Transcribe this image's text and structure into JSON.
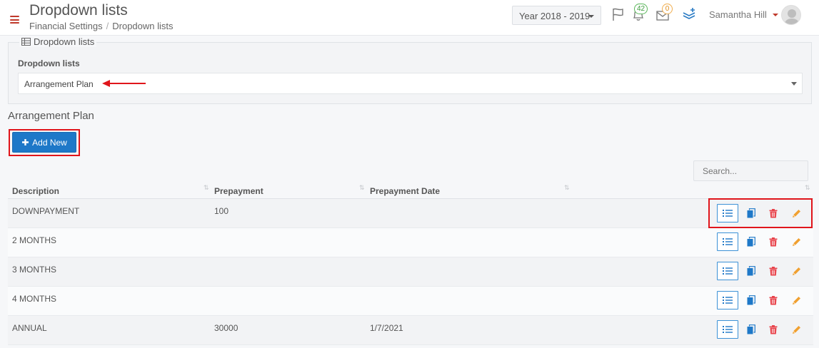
{
  "header": {
    "title": "Dropdown lists",
    "breadcrumb": [
      "Financial Settings",
      "Dropdown lists"
    ],
    "year_select": "Year 2018 - 2019",
    "notifications_count": "42",
    "messages_count": "0",
    "user_name": "Samantha Hill"
  },
  "filter": {
    "legend": "Dropdown lists",
    "label": "Dropdown lists",
    "selected": "Arrangement Plan"
  },
  "section": {
    "title": "Arrangement Plan",
    "add_button": "Add New"
  },
  "table": {
    "search_placeholder": "Search...",
    "columns": [
      "Description",
      "Prepayment",
      "Prepayment Date",
      ""
    ],
    "rows": [
      {
        "description": "DOWNPAYMENT",
        "prepayment": "100",
        "prepayment_date": ""
      },
      {
        "description": "2 MONTHS",
        "prepayment": "",
        "prepayment_date": ""
      },
      {
        "description": "3 MONTHS",
        "prepayment": "",
        "prepayment_date": ""
      },
      {
        "description": "4 MONTHS",
        "prepayment": "",
        "prepayment_date": ""
      },
      {
        "description": "ANNUAL",
        "prepayment": "30000",
        "prepayment_date": "1/7/2021"
      }
    ]
  },
  "colors": {
    "accent": "#1e78c8",
    "highlight": "#e0151b",
    "delete": "#e8434b",
    "edit": "#f0a030"
  }
}
